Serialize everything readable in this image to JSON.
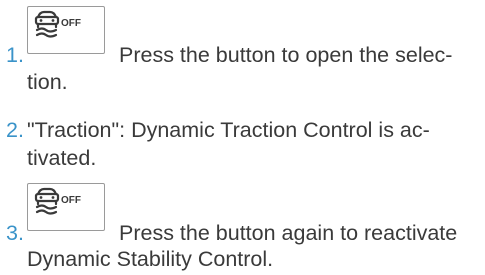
{
  "steps": [
    {
      "number": "1.",
      "icon": "dsc-off-icon",
      "icon_label": "OFF",
      "line1": "Press the button to open the selec-",
      "line2": "tion."
    },
    {
      "number": "2.",
      "line1": "\"Traction\": Dynamic Traction Control is ac-",
      "line2": "tivated."
    },
    {
      "number": "3.",
      "icon": "dsc-off-icon",
      "icon_label": "OFF",
      "line1": "Press the button again to reactivate",
      "line2": "Dynamic Stability Control."
    }
  ],
  "colors": {
    "number": "#3a93c9",
    "text": "#3a3a3a",
    "icon_border": "#9a9a9a"
  }
}
